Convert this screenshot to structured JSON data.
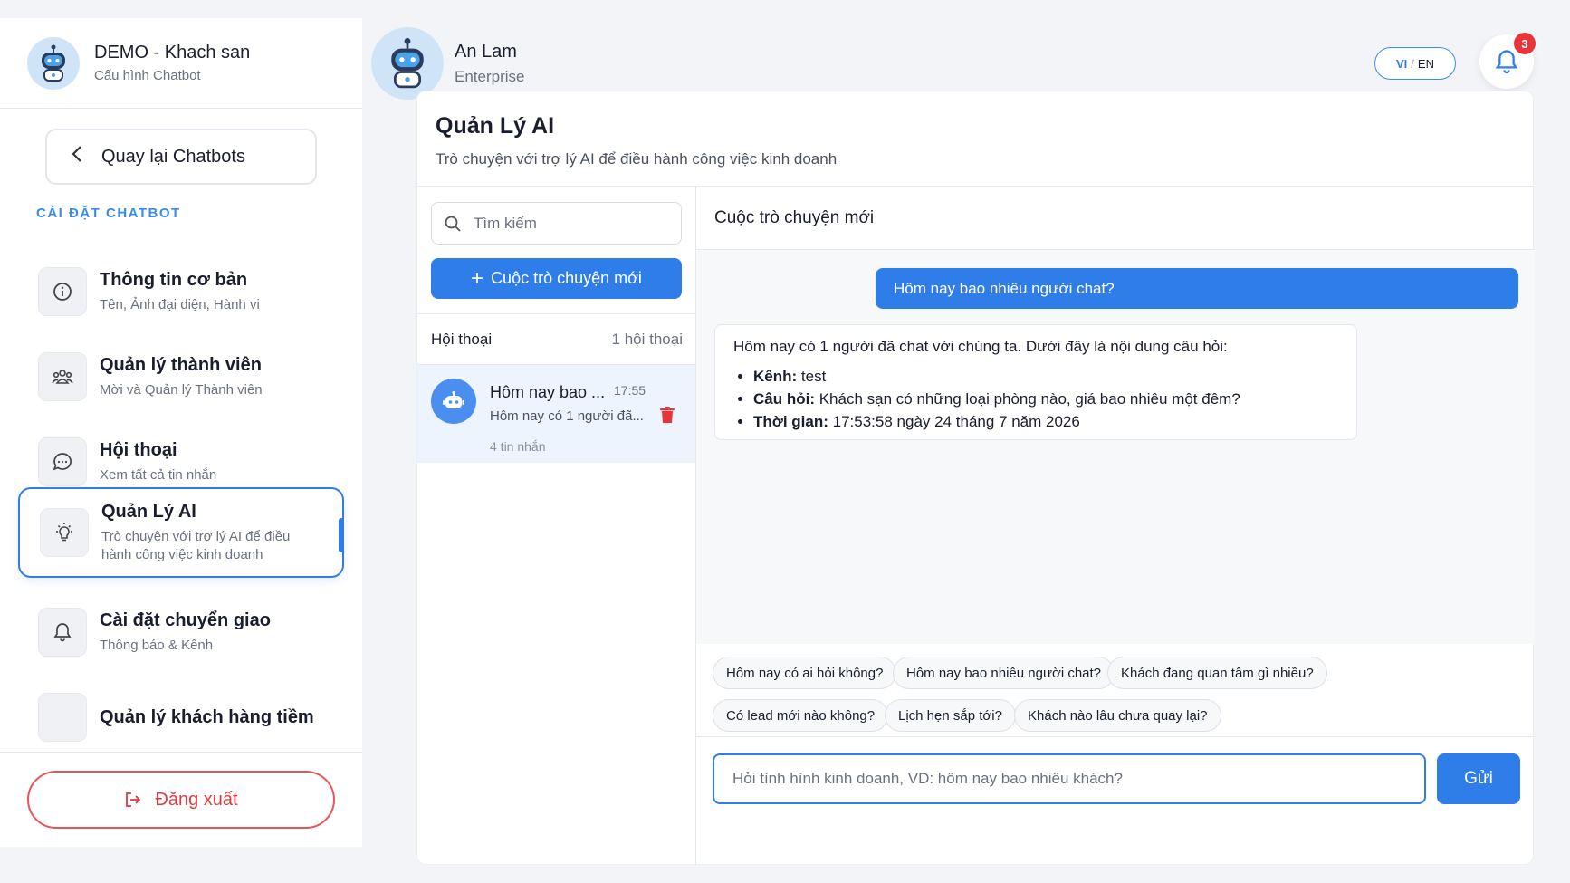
{
  "sidebar": {
    "app_title": "DEMO - Khach san",
    "app_subtitle": "Cấu hình Chatbot",
    "back_label": "Quay lại Chatbots",
    "section_label": "CÀI ĐẶT CHATBOT",
    "items": [
      {
        "title": "Thông tin cơ bản",
        "desc": "Tên, Ảnh đại diện, Hành vi",
        "icon": "info-icon"
      },
      {
        "title": "Quản lý thành viên",
        "desc": "Mời và Quản lý Thành viên",
        "icon": "users-icon"
      },
      {
        "title": "Hội thoại",
        "desc": "Xem tất cả tin nhắn",
        "icon": "chat-bubble-icon"
      },
      {
        "title": "Quản Lý AI",
        "desc": "Trò chuyện với trợ lý AI để điều",
        "desc2": "hành công việc kinh doanh",
        "icon": "lightbulb-icon",
        "active": true
      },
      {
        "title": "Cài đặt chuyển giao",
        "desc": "Thông báo & Kênh",
        "icon": "bell-icon"
      },
      {
        "title": "Quản lý khách hàng tiềm",
        "desc": "",
        "icon": "lead-icon"
      }
    ],
    "logout_label": "Đăng xuất"
  },
  "topbar": {
    "user_name": "An Lam",
    "user_plan": "Enterprise",
    "lang_vi": "VI",
    "lang_sep": "/",
    "lang_en": "EN",
    "notification_count": "3"
  },
  "main": {
    "title": "Quản Lý AI",
    "subtitle": "Trò chuyện với trợ lý AI để điều hành công việc kinh doanh"
  },
  "conversations": {
    "search_placeholder": "Tìm kiếm",
    "new_button": "Cuộc trò chuyện mới",
    "list_header": "Hội thoại",
    "list_count": "1 hội thoại",
    "items": [
      {
        "title": "Hôm nay bao ...",
        "time": "17:55",
        "preview": "Hôm nay có 1 người đã...",
        "meta": "4 tin nhắn"
      }
    ]
  },
  "chat": {
    "header": "Cuộc trò chuyện mới",
    "user_message": "Hôm nay bao nhiêu người chat?",
    "bot_intro": "Hôm nay có 1 người đã chat với chúng ta. Dưới đây là nội dung câu hỏi:",
    "bot_items": [
      {
        "label": "Kênh:",
        "value": " test"
      },
      {
        "label": "Câu hỏi:",
        "value": " Khách sạn có những loại phòng nào, giá bao nhiêu một đêm?"
      },
      {
        "label": "Thời gian:",
        "value": " 17:53:58 ngày 24 tháng 7 năm 2026"
      }
    ],
    "suggestions": [
      "Hôm nay có ai hỏi không?",
      "Hôm nay bao nhiêu người chat?",
      "Khách đang quan tâm gì nhiều?",
      "Có lead mới nào không?",
      "Lịch hẹn sắp tới?",
      "Khách nào lâu chưa quay lại?"
    ],
    "input_placeholder": "Hỏi tình hình kinh doanh, VD: hôm nay bao nhiêu khách?",
    "send_label": "Gửi"
  },
  "colors": {
    "accent": "#2f7de8",
    "danger": "#e03a40",
    "badge": "#e8353b"
  }
}
